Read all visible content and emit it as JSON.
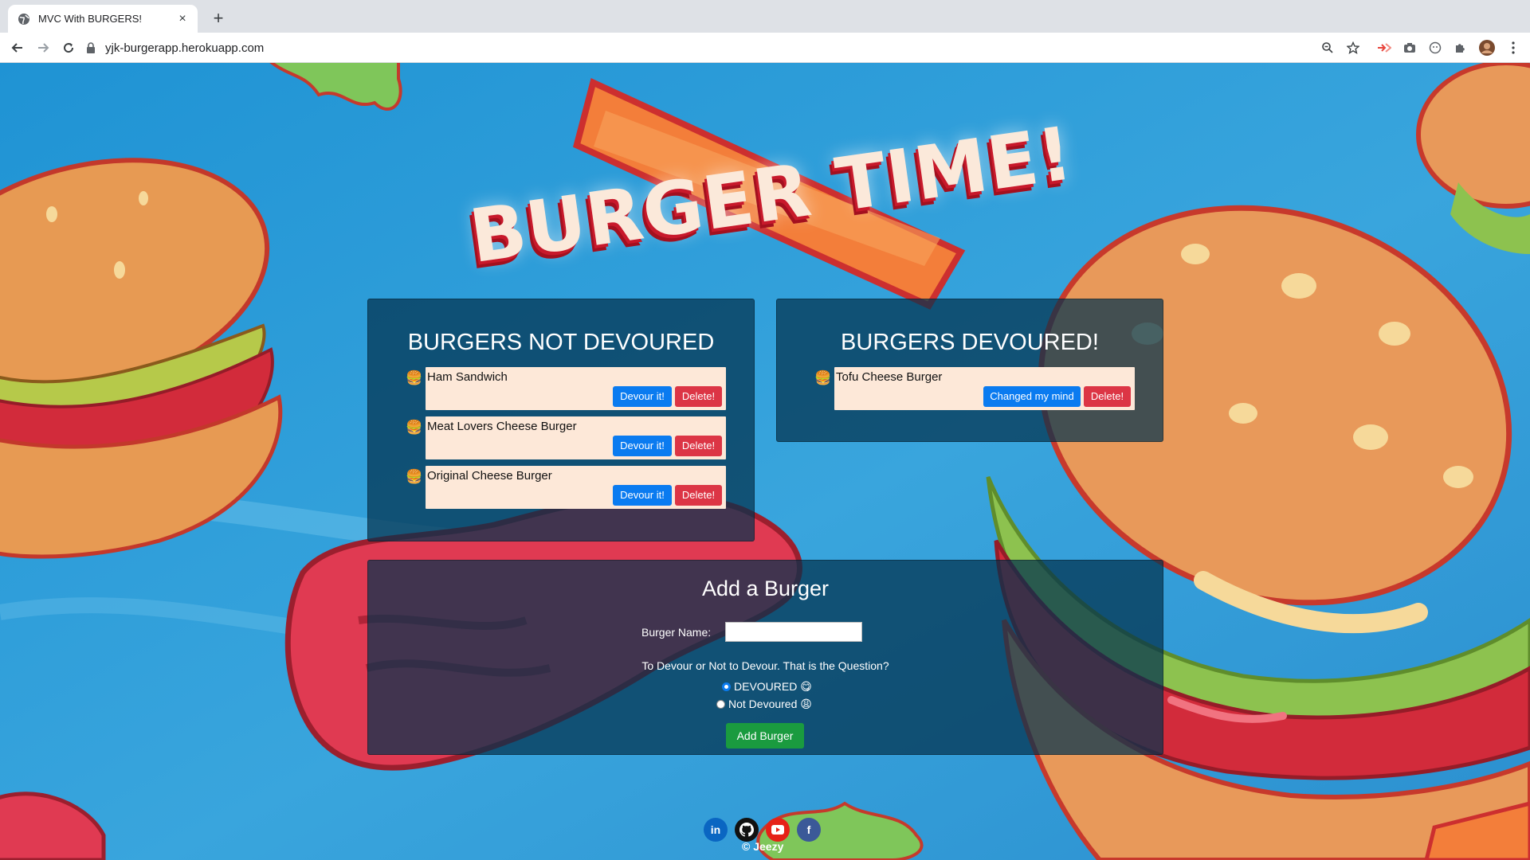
{
  "browser": {
    "tab_title": "MVC With BURGERS!",
    "tab_close": "×",
    "new_tab": "+",
    "url": "yjk-burgerapp.herokuapp.com"
  },
  "hero": {
    "title": "BURGER TIME!"
  },
  "not_devoured": {
    "title": "BURGERS NOT DEVOURED",
    "items": [
      {
        "name": "Ham Sandwich",
        "action": "Devour it!",
        "delete": "Delete!"
      },
      {
        "name": "Meat Lovers Cheese Burger",
        "action": "Devour it!",
        "delete": "Delete!"
      },
      {
        "name": "Original Cheese Burger",
        "action": "Devour it!",
        "delete": "Delete!"
      }
    ]
  },
  "devoured": {
    "title": "BURGERS DEVOURED!",
    "items": [
      {
        "name": "Tofu Cheese Burger",
        "action": "Changed my mind",
        "delete": "Delete!"
      }
    ]
  },
  "form": {
    "title": "Add a Burger",
    "name_label": "Burger Name:",
    "name_value": "",
    "question": "To Devour or Not to Devour. That is the Question?",
    "option_devoured": "DEVOURED 😋",
    "option_not_devoured": "Not Devoured 😩",
    "submit": "Add Burger"
  },
  "footer": {
    "social": [
      {
        "label": "in",
        "icon": "linkedin-icon",
        "color": "#0a66c2"
      },
      {
        "label": "⌥",
        "icon": "github-icon",
        "color": "#111111"
      },
      {
        "label": "▶",
        "icon": "youtube-icon",
        "color": "#e62117"
      },
      {
        "label": "f",
        "icon": "facebook-icon",
        "color": "#3b5998"
      }
    ],
    "copyright": "© Jeezy"
  },
  "emoji": {
    "burger": "🍔"
  },
  "colors": {
    "panel": "#03324e",
    "blue_button": "#0a7bf0",
    "red_button": "#dc3545",
    "green_button": "#1a9b3f",
    "card": "#fde8d8"
  }
}
